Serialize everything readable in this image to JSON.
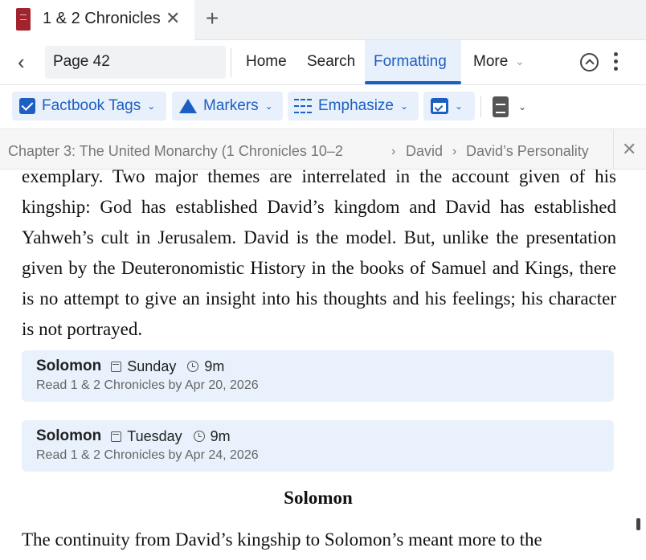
{
  "tab": {
    "title": "1 & 2 Chronicles",
    "close": "✕",
    "new_tab": "+"
  },
  "navbar": {
    "back": "‹",
    "page_field": "Page 42",
    "items": [
      "Home",
      "Search",
      "Formatting",
      "More"
    ],
    "active": "Formatting",
    "more_chevron": "⌄"
  },
  "toolbar": {
    "factbook_label": "Factbook Tags",
    "markers_label": "Markers",
    "emphasize_label": "Emphasize",
    "chevron": "⌄"
  },
  "breadcrumb": {
    "item1": "Chapter 3: The United Monarchy (1 Chronicles 10–2",
    "item2": "David",
    "item3": "David’s Personality",
    "separator": "›",
    "close": "✕"
  },
  "content": {
    "paragraph_1": "exemplary. Two major themes are interrelated in the account given of his kingship: God has established David’s kingdom and David has established Yahweh’s cult in Jerusalem. David is the model. But, unlike the presentation given by the Deuteronomistic History in the books of Samuel and Kings, there is no attempt to give an insight into his thoughts and his feelings; his character is not portrayed.",
    "cards": [
      {
        "name": "Solomon",
        "day": "Sunday",
        "duration": "9m",
        "subtitle": "Read 1 & 2 Chronicles by Apr 20, 2026"
      },
      {
        "name": "Solomon",
        "day": "Tuesday",
        "duration": "9m",
        "subtitle": "Read 1 & 2 Chronicles by Apr 24, 2026"
      }
    ],
    "heading": "Solomon",
    "paragraph_2": "The continuity from David’s kingship to Solomon’s meant more to the"
  },
  "colors": {
    "accent": "#1c5fc2",
    "accent_bg": "#e8f0fc",
    "card_bg": "#e9f2fc",
    "book_icon": "#a1232e"
  }
}
